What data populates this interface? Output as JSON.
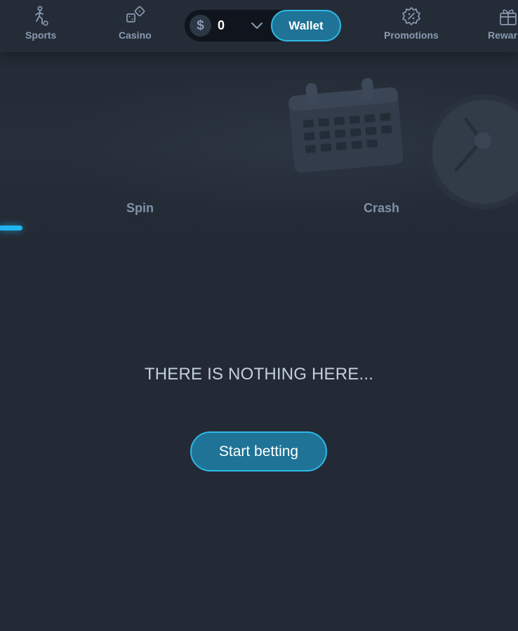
{
  "nav": {
    "sports": {
      "label": "Sports",
      "icon": "soccer-player-icon"
    },
    "casino": {
      "label": "Casino",
      "icon": "dice-icon"
    },
    "promotions": {
      "label": "Promotions",
      "icon": "promo-badge-icon"
    },
    "rewards": {
      "label": "Rewar",
      "icon": "gift-icon"
    }
  },
  "balance": {
    "currency_symbol": "$",
    "amount": "0",
    "wallet_label": "Wallet"
  },
  "game_tabs": {
    "spin": "Spin",
    "crash": "Crash"
  },
  "empty_state": {
    "message": "THERE IS NOTHING HERE...",
    "cta_label": "Start betting"
  },
  "colors": {
    "background": "#232a35",
    "accent": "#2fb8e6",
    "button_fill": "#1e7396",
    "muted_text": "#8a9bb1"
  }
}
